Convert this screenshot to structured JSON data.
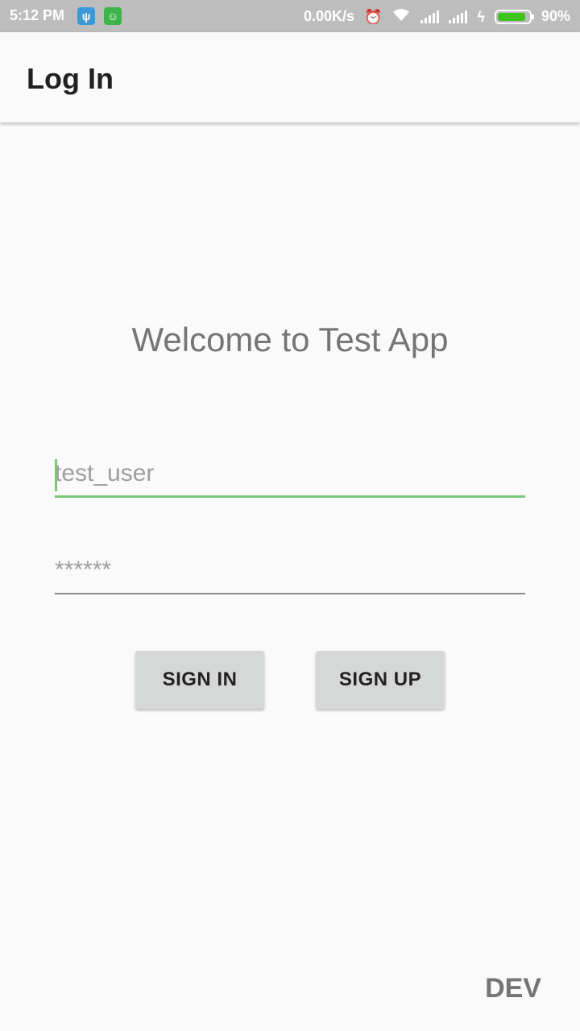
{
  "status_bar": {
    "time": "5:12 PM",
    "net_speed": "0.00K/s",
    "battery_percent": "90%",
    "battery_level": 0.9,
    "icons": [
      "usb-icon",
      "cat-app-icon",
      "alarm-icon",
      "wifi-icon",
      "signal-icon",
      "signal-icon",
      "charging-icon",
      "battery-icon"
    ]
  },
  "app_bar": {
    "title": "Log In"
  },
  "main": {
    "welcome": "Welcome to Test App",
    "username_placeholder": "test_user",
    "password_placeholder": "******",
    "sign_in_label": "SIGN IN",
    "sign_up_label": "SIGN UP"
  },
  "footer": {
    "env_label": "DEV"
  },
  "colors": {
    "accent": "#7bc67b",
    "status_bar": "#bdbdbd",
    "button": "#d6d7d7",
    "background": "#fafafa"
  }
}
